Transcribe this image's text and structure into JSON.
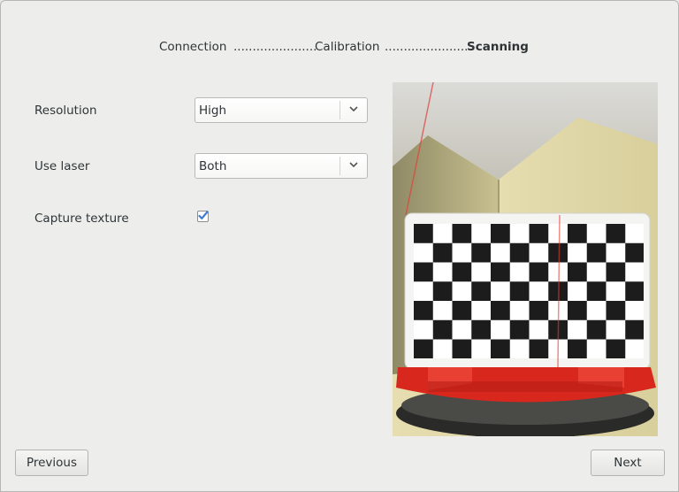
{
  "steps": {
    "connection": "Connection",
    "dots1": "......................",
    "calibration": "Calibration",
    "dots2": "......................",
    "scanning": "Scanning"
  },
  "settings": {
    "resolution_label": "Resolution",
    "resolution_value": "High",
    "laser_label": "Use laser",
    "laser_value": "Both",
    "texture_label": "Capture texture",
    "texture_checked": true
  },
  "buttons": {
    "previous": "Previous",
    "next": "Next"
  },
  "colors": {
    "laser": "#e0403a",
    "platform": "#d8281e",
    "check_accent": "#3f7bd3"
  }
}
